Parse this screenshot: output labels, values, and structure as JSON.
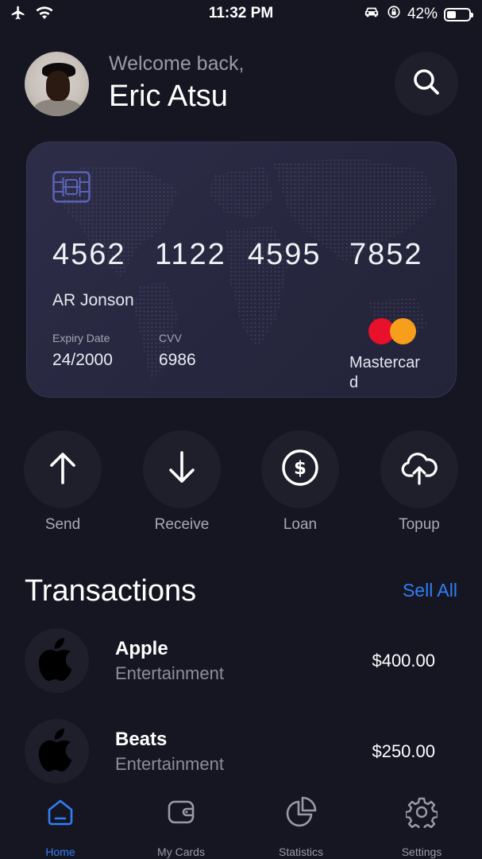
{
  "status_bar": {
    "time": "11:32 PM",
    "battery": "42%",
    "battery_level": 0.42
  },
  "header": {
    "welcome": "Welcome back,",
    "user_name": "Eric Atsu"
  },
  "card": {
    "number_groups": [
      "4562",
      "1122",
      "4595",
      "7852"
    ],
    "holder": "AR Jonson",
    "expiry_label": "Expiry Date",
    "expiry_value": "24/2000",
    "cvv_label": "CVV",
    "cvv_value": "6986",
    "brand": "Mastercard",
    "brand_colors": [
      "#e8102a",
      "#f79e1b"
    ]
  },
  "actions": [
    {
      "label": "Send",
      "icon": "arrow-up-icon"
    },
    {
      "label": "Receive",
      "icon": "arrow-down-icon"
    },
    {
      "label": "Loan",
      "icon": "dollar-circle-icon"
    },
    {
      "label": "Topup",
      "icon": "cloud-upload-icon"
    }
  ],
  "transactions": {
    "title": "Transactions",
    "see_all": "Sell All",
    "items": [
      {
        "name": "Apple",
        "category": "Entertainment",
        "amount": "$400.00",
        "icon": "apple-icon"
      },
      {
        "name": "Beats",
        "category": "Entertainment",
        "amount": "$250.00",
        "icon": "apple-icon"
      }
    ]
  },
  "nav": {
    "active": "Home",
    "items": [
      {
        "label": "Home",
        "icon": "home-icon"
      },
      {
        "label": "My Cards",
        "icon": "wallet-icon"
      },
      {
        "label": "Statistics",
        "icon": "pie-chart-icon"
      },
      {
        "label": "Settings",
        "icon": "gear-icon"
      }
    ]
  },
  "colors": {
    "background": "#161622",
    "surface": "#1f1f2c",
    "accent": "#2f7ff6",
    "muted_text": "#9a9aa6"
  }
}
